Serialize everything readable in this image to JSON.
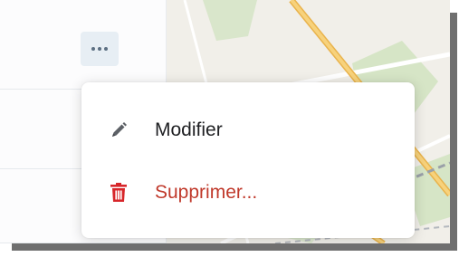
{
  "menu": {
    "items": [
      {
        "label": "Modifier",
        "icon": "pencil-icon",
        "color": "#1e1f22",
        "icon_color": "#5d6167"
      },
      {
        "label": "Supprimer...",
        "icon": "trash-icon",
        "color": "#c0392b",
        "icon_color": "#d7262a"
      }
    ]
  },
  "toolbar": {
    "more_icon": "ellipsis-icon"
  },
  "colors": {
    "map_background": "#f1efe9",
    "map_park": "#d4e3c4",
    "map_road": "#f1c35a",
    "more_button_bg": "#e7eef4"
  }
}
